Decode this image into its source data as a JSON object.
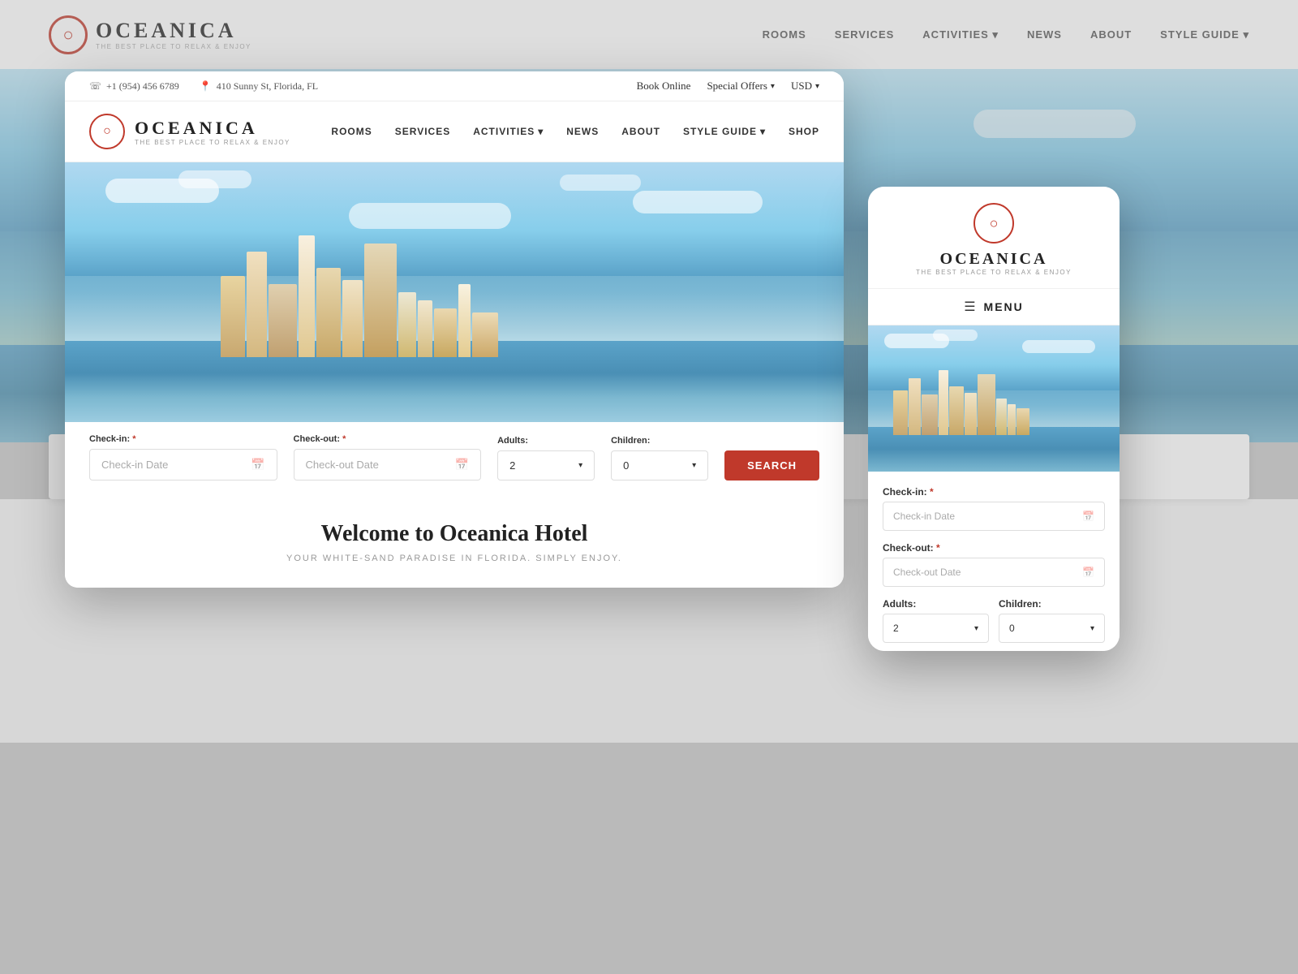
{
  "site": {
    "brand": "OCEANICA",
    "tagline": "THE BEST PLACE TO RELAX & ENJOY",
    "logo_symbol": "○"
  },
  "background": {
    "phone": "+1 (954) 456 6789",
    "address": "410 Sunny St, Florida, FL",
    "nav_items": [
      "ROOMS",
      "SERVICES",
      "ACTIVITIES ▾",
      "NEWS",
      "ABOUT",
      "STYLE GUIDE ▾"
    ],
    "topbar_items": [
      "Book Online",
      "Special Offers",
      "USD"
    ]
  },
  "desktop": {
    "topbar": {
      "phone": "+1 (954) 456 6789",
      "address": "410 Sunny St, Florida, FL",
      "book_online": "Book Online",
      "special_offers": "Special Offers",
      "currency": "USD"
    },
    "nav": {
      "brand": "OCEANICA",
      "tagline": "THE BEST PLACE TO RELAX & ENJOY",
      "links": [
        "ROOMS",
        "SERVICES",
        "ACTIVITIES",
        "NEWS",
        "ABOUT",
        "STYLE GUIDE",
        "SHOP"
      ]
    },
    "booking": {
      "checkin_label": "Check-in:",
      "checkin_placeholder": "Check-in Date",
      "checkout_label": "Check-out:",
      "checkout_placeholder": "Check-out Date",
      "adults_label": "Adults:",
      "adults_value": "2",
      "children_label": "Children:",
      "children_value": "0",
      "required_marker": "*",
      "search_button": "SEARCH"
    },
    "welcome": {
      "heading": "Welcome to Oceanica Hotel",
      "subheading": "YOUR WHITE-SAND PARADISE IN FLORIDA. SIMPLY ENJOY."
    }
  },
  "mobile": {
    "brand": "OCEANICA",
    "tagline": "THE BEST PLACE TO RELAX & ENJOY",
    "menu_label": "MENU",
    "booking": {
      "checkin_label": "Check-in:",
      "checkin_placeholder": "Check-in Date",
      "checkout_label": "Check-out:",
      "checkout_placeholder": "Check-out Date",
      "adults_label": "Adults:",
      "adults_value": "2",
      "children_label": "Children:",
      "children_value": "0",
      "required_marker": "*"
    }
  },
  "page_bottom": {
    "heading": "Welcome to Oceanica Hotel"
  },
  "colors": {
    "accent": "#c0392b",
    "dark": "#222222",
    "light_text": "#999999",
    "border": "#dddddd"
  }
}
